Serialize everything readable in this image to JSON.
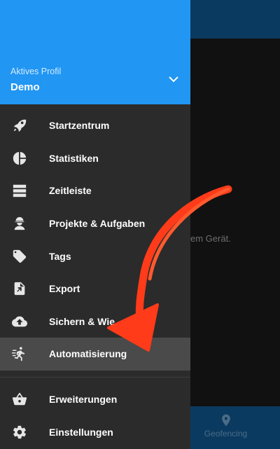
{
  "background": {
    "hint_text": "em Gerät.",
    "bottom_nav": {
      "geofencing_label": "Geofencing",
      "icon": "location-pin-icon"
    }
  },
  "drawer": {
    "header": {
      "caption": "Aktives Profil",
      "profile_name": "Demo",
      "chevron_icon": "chevron-down-icon"
    },
    "items": [
      {
        "label": "Startzentrum",
        "icon": "rocket-icon"
      },
      {
        "label": "Statistiken",
        "icon": "pie-chart-icon"
      },
      {
        "label": "Zeitleiste",
        "icon": "list-icon"
      },
      {
        "label": "Projekte & Aufgaben",
        "icon": "worker-icon"
      },
      {
        "label": "Tags",
        "icon": "tag-icon"
      },
      {
        "label": "Export",
        "icon": "file-export-icon"
      },
      {
        "label": "Sichern & Wie",
        "icon": "cloud-upload-icon"
      },
      {
        "label": "Automatisierung",
        "icon": "running-person-icon",
        "active": true
      }
    ],
    "secondary_items": [
      {
        "label": "Erweiterungen",
        "icon": "basket-icon"
      },
      {
        "label": "Einstellungen",
        "icon": "gear-icon"
      }
    ]
  },
  "colors": {
    "header_blue": "#2196f3",
    "drawer_bg": "#2b2b2b",
    "active_row": "#4a4a4a",
    "annotation_arrow": "#ff3b1a"
  }
}
